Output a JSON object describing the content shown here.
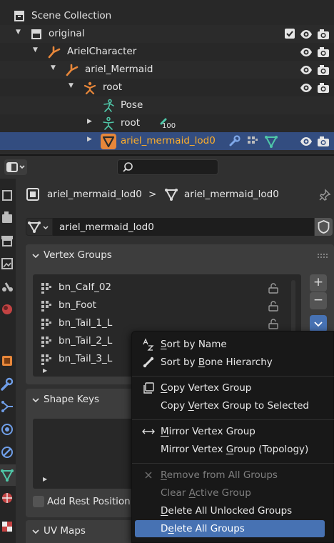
{
  "outliner": {
    "rows": [
      {
        "label": "Scene Collection"
      },
      {
        "label": "original"
      },
      {
        "label": "ArielCharacter"
      },
      {
        "label": "ariel_Mermaid"
      },
      {
        "label": "root"
      },
      {
        "label": "Pose"
      },
      {
        "label": "root",
        "badge": "100"
      },
      {
        "label": "ariel_mermaid_lod0"
      }
    ]
  },
  "breadcrumb": {
    "object_name": "ariel_mermaid_lod0",
    "separator": ">",
    "mesh_name": "ariel_mermaid_lod0"
  },
  "datablock": {
    "name": "ariel_mermaid_lod0"
  },
  "vertex_groups": {
    "title": "Vertex Groups",
    "items": [
      "bn_Calf_02",
      "bn_Foot",
      "bn_Tail_1_L",
      "bn_Tail_2_L",
      "bn_Tail_3_L"
    ],
    "add_label": "+",
    "remove_label": "−"
  },
  "shape_keys": {
    "title": "Shape Keys",
    "add_rest_label": "Add Rest Position"
  },
  "uv_maps": {
    "title": "UV Maps"
  },
  "context_menu": {
    "items": [
      {
        "pre": "",
        "u": "S",
        "post": "ort by Name",
        "icon": "sort-alpha-icon",
        "state": "normal"
      },
      {
        "pre": "Sort by ",
        "u": "B",
        "post": "one Hierarchy",
        "icon": "bone-icon",
        "state": "normal"
      },
      {
        "pre": "",
        "u": "C",
        "post": "opy Vertex Group",
        "icon": "duplicate-icon",
        "state": "normal"
      },
      {
        "pre": "Copy ",
        "u": "V",
        "post": "ertex Group to Selected",
        "icon": "",
        "state": "normal"
      },
      {
        "pre": "",
        "u": "M",
        "post": "irror Vertex Group",
        "icon": "mirror-arrows-icon",
        "state": "normal"
      },
      {
        "pre": "Mirror Vertex ",
        "u": "G",
        "post": "roup (Topology)",
        "icon": "",
        "state": "normal"
      },
      {
        "pre": "",
        "u": "R",
        "post": "emove from All Groups",
        "icon": "x-icon",
        "state": "disabled"
      },
      {
        "pre": "Clear ",
        "u": "A",
        "post": "ctive Group",
        "icon": "",
        "state": "disabled"
      },
      {
        "pre": "",
        "u": "D",
        "post": "elete All Unlocked Groups",
        "icon": "",
        "state": "normal"
      },
      {
        "pre": "D",
        "u": "e",
        "post": "lete All Groups",
        "icon": "",
        "state": "highlighted"
      }
    ]
  },
  "colors": {
    "selection": "#334d80",
    "active_object_text": "#ffaf29",
    "menu_highlight": "#4772b3",
    "armature_orange": "#e8873a",
    "vertex_group_green": "#4fc7a8"
  }
}
